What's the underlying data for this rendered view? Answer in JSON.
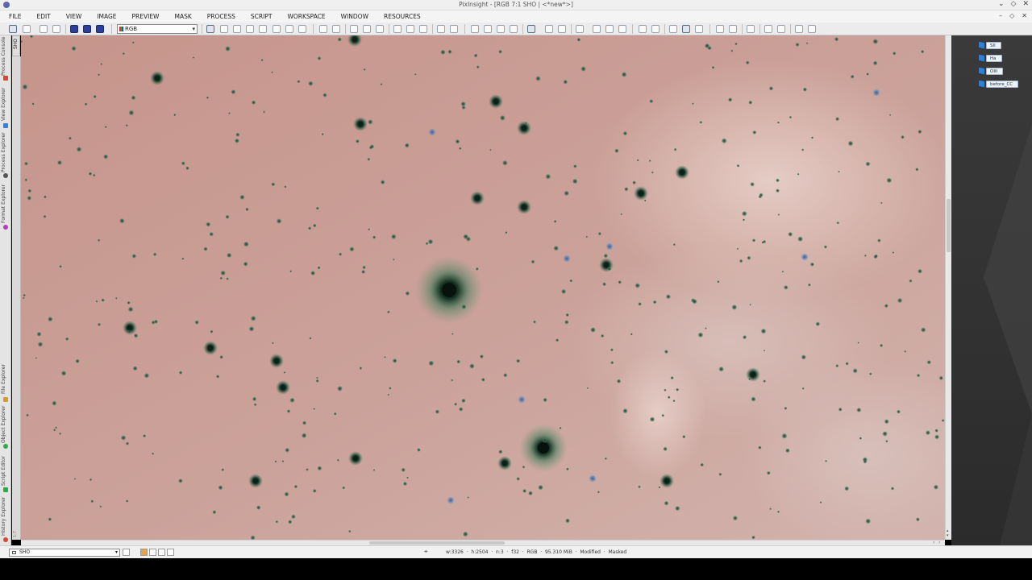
{
  "window": {
    "title": "PixInsight - [RGB 7:1 SHO | <*new*>]",
    "controls": [
      "⌄",
      "◇",
      "✕"
    ]
  },
  "menu": [
    "FILE",
    "EDIT",
    "VIEW",
    "IMAGE",
    "PREVIEW",
    "MASK",
    "PROCESS",
    "SCRIPT",
    "WORKSPACE",
    "WINDOW",
    "RESOURCES"
  ],
  "mdi_controls": [
    "–",
    "◇",
    "✕"
  ],
  "toolbar": {
    "channel_select": "RGB"
  },
  "left_dock": {
    "tabs": [
      {
        "label": "Process Console",
        "icon_color": "#d04a3a"
      },
      {
        "label": "View Explorer",
        "icon_color": "#3a7fd0"
      },
      {
        "label": "Process Explorer",
        "icon_color": "#555555"
      },
      {
        "label": "Format Explorer",
        "icon_color": "#b13fb8"
      },
      {
        "label": "File Explorer",
        "icon_color": "#d39a3a"
      },
      {
        "label": "Object Explorer",
        "icon_color": "#2fa84a"
      },
      {
        "label": "Script Editor",
        "icon_color": "#2fa84a"
      },
      {
        "label": "History Explorer",
        "icon_color": "#d04a3a"
      }
    ]
  },
  "view": {
    "id_tab": "SHO",
    "frame_corner": "1:7"
  },
  "workspace_icons": [
    "SII",
    "Ha",
    "OIII",
    "before_CC"
  ],
  "statusbar": {
    "view_selector": "SHO",
    "info": "w:3326  ·  h:2504  ·  n:3  ·  f32  ·  RGB  ·  95.310 MiB  ·  Modified  ·  Masked"
  },
  "colors": {
    "sky_background": "#c99a91",
    "star_core": "#0b1a12",
    "star_halo": "#2f6a4c",
    "blue_star": "#3a66a8"
  }
}
